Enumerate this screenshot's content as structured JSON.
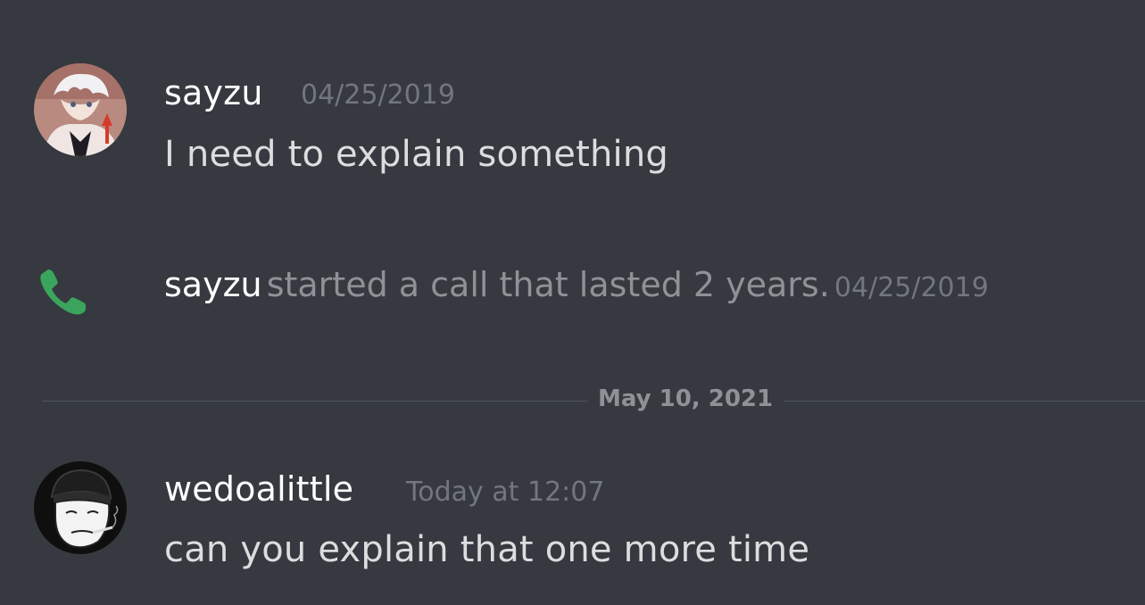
{
  "messages": [
    {
      "author": "sayzu",
      "timestamp": "04/25/2019",
      "text": "I need to explain something",
      "avatar_icon": "anime-avatar"
    },
    {
      "type": "call",
      "author": "sayzu",
      "text": "started a call that lasted 2 years.",
      "timestamp": "04/25/2019",
      "icon": "phone-icon",
      "icon_color": "#3ba55d"
    },
    {
      "author": "wedoalittle",
      "timestamp": "Today at 12:07",
      "text": "can you explain that one more time",
      "avatar_icon": "wojak-avatar"
    }
  ],
  "divider": {
    "label": "May 10, 2021"
  },
  "colors": {
    "background": "#36393f",
    "author": "#ffffff",
    "text": "#dcddde",
    "muted": "#72767d"
  }
}
